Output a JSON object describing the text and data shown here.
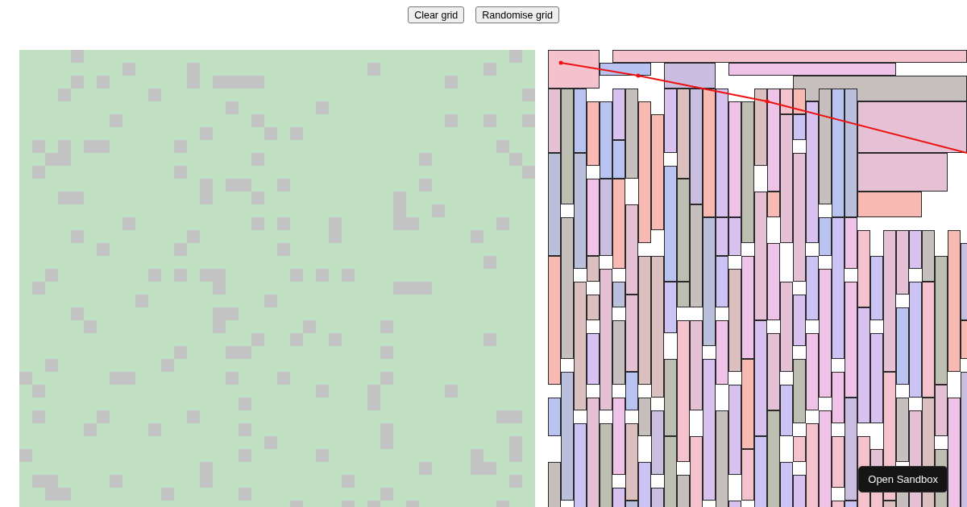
{
  "toolbar": {
    "buttons": [
      {
        "label": "Clear grid"
      },
      {
        "label": "Randomise grid"
      }
    ]
  },
  "sandbox_button": {
    "label": "Open Sandbox"
  }
}
